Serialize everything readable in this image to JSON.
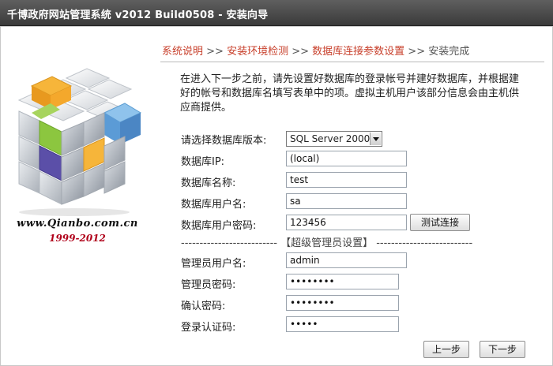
{
  "window": {
    "title": "千博政府网站管理系统  v2012 Build0508 - 安装向导"
  },
  "brand": {
    "site_url": "www.Qianbo.com.cn",
    "years": "1999-2012",
    "logo_icon": "rubiks-cube-logo"
  },
  "steps": {
    "step1": "系统说明",
    "sep1": " >> ",
    "step2": "安装环境检测",
    "sep2": " >> ",
    "step3": "数据库连接参数设置",
    "sep3": " >> ",
    "step4": "安装完成"
  },
  "intro": "在进入下一步之前，请先设置好数据库的登录帐号并建好数据库，并根据建好的帐号和数据库名填写表单中的项。虚拟主机用户该部分信息会由主机供应商提供。",
  "form": {
    "db_version_label": "请选择数据库版本:",
    "db_version_value": "SQL Server 2000",
    "db_ip_label": "数据库IP:",
    "db_ip_value": "(local)",
    "db_name_label": "数据库名称:",
    "db_name_value": "test",
    "db_user_label": "数据库用户名:",
    "db_user_value": "sa",
    "db_pass_label": "数据库用户密码:",
    "db_pass_value": "123456",
    "test_button": "测试连接",
    "admin_section": "-------------------------- 【超级管理员设置】 --------------------------",
    "admin_user_label": "管理员用户名:",
    "admin_user_value": "admin",
    "admin_pass_label": "管理员密码:",
    "admin_pass_value": "12345678",
    "confirm_pass_label": "确认密码:",
    "confirm_pass_value": "12345678",
    "auth_code_label": "登录认证码:",
    "auth_code_value": "12345"
  },
  "nav": {
    "prev_button": "上一步",
    "next_button": "下一步"
  },
  "colors": {
    "title_bar": "#4a4a4a",
    "step_done": "#c8402c",
    "step_todo": "#555555",
    "years": "#b0001a"
  }
}
